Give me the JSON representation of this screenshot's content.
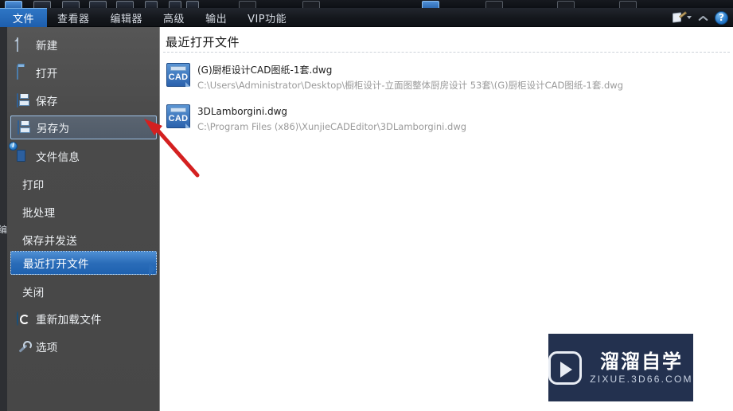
{
  "toolbar": {
    "quick_icons": [
      {
        "name": "new-doc-icon",
        "selected": true
      },
      {
        "name": "open-file-icon",
        "selected": false
      },
      {
        "name": "save-file-icon",
        "selected": false
      },
      {
        "name": "save-as-icon",
        "selected": false
      },
      {
        "name": "print-icon",
        "selected": false
      },
      {
        "name": "layer-icon",
        "selected": false
      },
      {
        "name": "measure-icon",
        "selected": false
      },
      {
        "name": "text-tool-icon",
        "selected": false
      },
      {
        "name": "grid-icon",
        "selected": false
      },
      {
        "name": "pan-icon",
        "selected": false
      },
      {
        "name": "zoom-tool-icon",
        "selected": false
      },
      {
        "name": "select-tool-icon",
        "selected": false
      }
    ]
  },
  "tabs": [
    {
      "label": "文件",
      "active": true
    },
    {
      "label": "查看器",
      "active": false
    },
    {
      "label": "编辑器",
      "active": false
    },
    {
      "label": "高级",
      "active": false
    },
    {
      "label": "输出",
      "active": false
    },
    {
      "label": "VIP功能",
      "active": false
    }
  ],
  "title_right_icons": [
    {
      "name": "signature-pen-icon"
    },
    {
      "name": "chevron-up-icon"
    },
    {
      "name": "help-icon",
      "glyph": "?"
    }
  ],
  "sidebar": {
    "edge_label": "编辑器",
    "items": [
      {
        "label": "新建",
        "icon": "new-document-icon",
        "state": "normal"
      },
      {
        "label": "打开",
        "icon": "open-folder-icon",
        "state": "normal"
      },
      {
        "label": "保存",
        "icon": "save-floppy-icon",
        "state": "normal"
      },
      {
        "label": "另存为",
        "icon": "save-as-floppy-icon",
        "state": "hover"
      },
      {
        "label": "文件信息",
        "icon": "file-info-icon",
        "state": "normal"
      },
      {
        "label": "打印",
        "icon": "",
        "state": "normal"
      },
      {
        "label": "批处理",
        "icon": "",
        "state": "normal"
      },
      {
        "label": "保存并发送",
        "icon": "",
        "state": "normal"
      },
      {
        "label": "最近打开文件",
        "icon": "",
        "state": "selected"
      },
      {
        "label": "关闭",
        "icon": "",
        "state": "normal"
      },
      {
        "label": "重新加载文件",
        "icon": "reload-icon",
        "state": "normal"
      },
      {
        "label": "选项",
        "icon": "wrench-options-icon",
        "state": "normal"
      }
    ]
  },
  "main": {
    "heading": "最近打开文件",
    "files": [
      {
        "name": "(G)厨柜设计CAD图纸-1套.dwg",
        "path": "C:\\Users\\Administrator\\Desktop\\橱柜设计-立面图整体厨房设计 53套\\(G)厨柜设计CAD图纸-1套.dwg",
        "icon": "cad-file-icon"
      },
      {
        "name": "3DLamborgini.dwg",
        "path": "C:\\Program Files (x86)\\XunjieCADEditor\\3DLamborgini.dwg",
        "icon": "cad-file-icon"
      }
    ]
  },
  "annotation": {
    "arrow_color": "#D42020",
    "name": "red-pointer-arrow"
  },
  "watermark": {
    "brand_cn": "溜溜自学",
    "brand_en": "ZIXUE.3D66.COM",
    "background": "#23314F"
  }
}
